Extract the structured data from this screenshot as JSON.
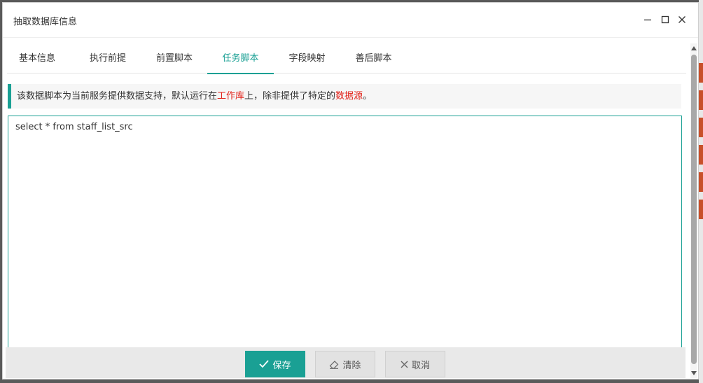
{
  "dialog": {
    "title": "抽取数据库信息"
  },
  "window_controls": [
    "minimize-icon",
    "maximize-icon",
    "close-icon"
  ],
  "tabs": [
    {
      "label": "基本信息",
      "active": false
    },
    {
      "label": "执行前提",
      "active": false
    },
    {
      "label": "前置脚本",
      "active": false
    },
    {
      "label": "任务脚本",
      "active": true
    },
    {
      "label": "字段映射",
      "active": false
    },
    {
      "label": "善后脚本",
      "active": false
    }
  ],
  "notice": {
    "part1": "该数据脚本为当前服务提供数据支持，默认运行在",
    "hl1": "工作库",
    "part2": "上，除非提供了特定的",
    "hl2": "数据源",
    "part3": "。"
  },
  "editor": {
    "value": "select * from staff_list_src"
  },
  "buttons": {
    "save": "保存",
    "clear": "清除",
    "cancel": "取消"
  },
  "colors": {
    "accent": "#1aa094",
    "highlight": "#e2231a"
  }
}
